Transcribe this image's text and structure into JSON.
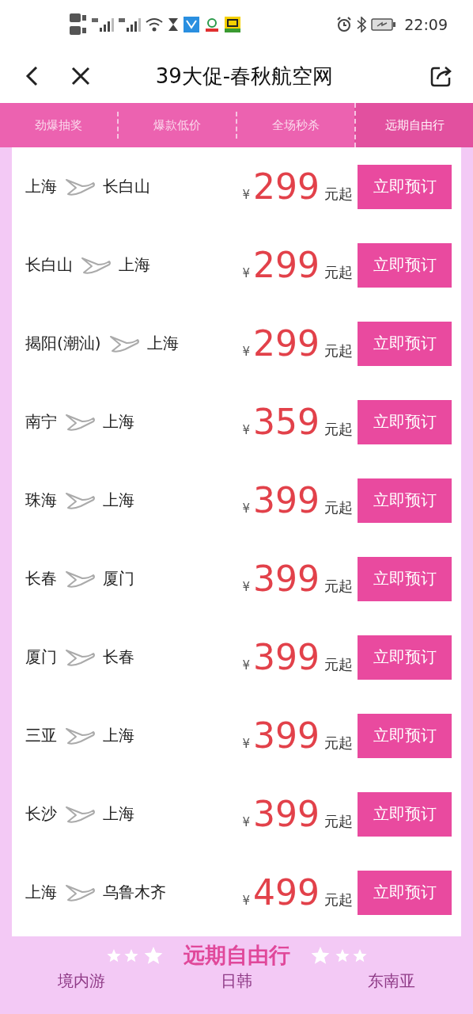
{
  "status_bar": {
    "time": "22:09"
  },
  "header": {
    "title": "39大促-春秋航空网"
  },
  "tabs": [
    {
      "label": "劲爆抽奖",
      "selected": false
    },
    {
      "label": "爆款低价",
      "selected": false
    },
    {
      "label": "全场秒杀",
      "selected": false
    },
    {
      "label": "远期自由行",
      "selected": true
    }
  ],
  "flights": [
    {
      "from": "上海",
      "to": "长白山",
      "currency": "¥",
      "price": "299",
      "suffix": "元起",
      "button": "立即预订"
    },
    {
      "from": "长白山",
      "to": "上海",
      "currency": "¥",
      "price": "299",
      "suffix": "元起",
      "button": "立即预订"
    },
    {
      "from": "揭阳(潮汕)",
      "to": "上海",
      "currency": "¥",
      "price": "299",
      "suffix": "元起",
      "button": "立即预订"
    },
    {
      "from": "南宁",
      "to": "上海",
      "currency": "¥",
      "price": "359",
      "suffix": "元起",
      "button": "立即预订"
    },
    {
      "from": "珠海",
      "to": "上海",
      "currency": "¥",
      "price": "399",
      "suffix": "元起",
      "button": "立即预订"
    },
    {
      "from": "长春",
      "to": "厦门",
      "currency": "¥",
      "price": "399",
      "suffix": "元起",
      "button": "立即预订"
    },
    {
      "from": "厦门",
      "to": "长春",
      "currency": "¥",
      "price": "399",
      "suffix": "元起",
      "button": "立即预订"
    },
    {
      "from": "三亚",
      "to": "上海",
      "currency": "¥",
      "price": "399",
      "suffix": "元起",
      "button": "立即预订"
    },
    {
      "from": "长沙",
      "to": "上海",
      "currency": "¥",
      "price": "399",
      "suffix": "元起",
      "button": "立即预订"
    },
    {
      "from": "上海",
      "to": "乌鲁木齐",
      "currency": "¥",
      "price": "499",
      "suffix": "元起",
      "button": "立即预订"
    }
  ],
  "section": {
    "title": "远期自由行",
    "subtabs": [
      "境内游",
      "日韩",
      "东南亚"
    ]
  }
}
